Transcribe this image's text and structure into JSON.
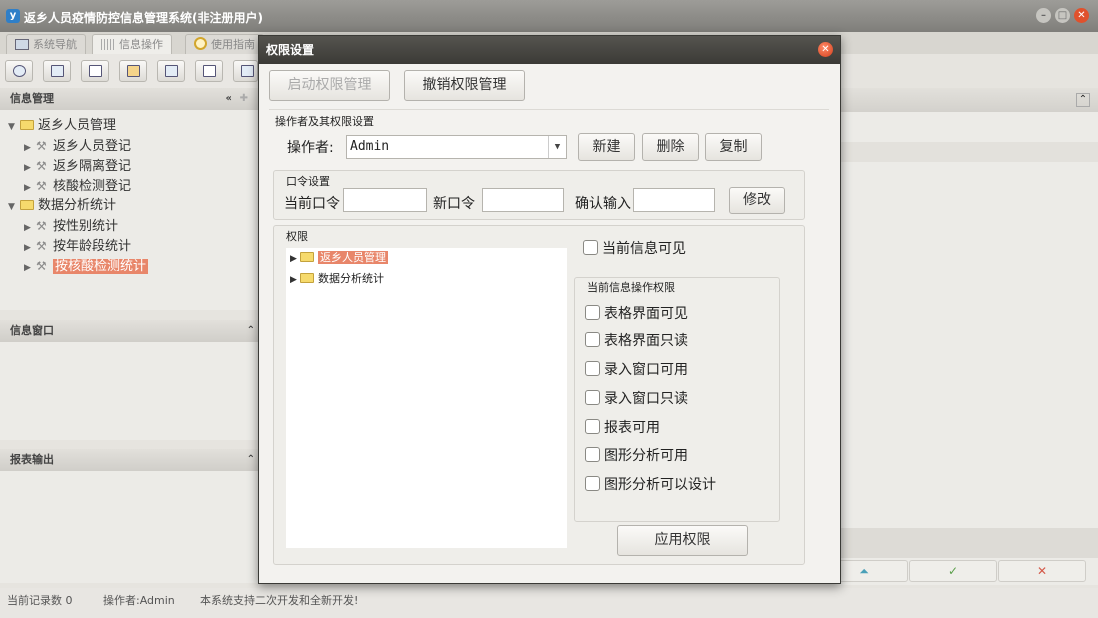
{
  "window": {
    "title": "返乡人员疫情防控信息管理系统(非注册用户)",
    "app_icon": "y"
  },
  "tabs": [
    {
      "label": "系统导航"
    },
    {
      "label": "信息操作"
    },
    {
      "label": "使用指南"
    }
  ],
  "panels": {
    "info_mgmt": "信息管理",
    "info_window": "信息窗口",
    "report_output": "报表输出"
  },
  "tree": [
    {
      "label": "返乡人员管理"
    },
    {
      "label": "返乡人员登记"
    },
    {
      "label": "返乡隔离登记"
    },
    {
      "label": "核酸检测登记"
    },
    {
      "label": "数据分析统计"
    },
    {
      "label": "按性别统计"
    },
    {
      "label": "按年龄段统计"
    },
    {
      "label": "按核酸检测统计"
    }
  ],
  "statusbar": {
    "records": "当前记录数 0",
    "operator": "操作者:Admin",
    "notice": "本系统支持二次开发和全新开发!"
  },
  "dialog": {
    "title": "权限设置",
    "start_btn": "启动权限管理",
    "revoke_btn": "撤销权限管理",
    "operator_group": "操作者及其权限设置",
    "operator_label": "操作者:",
    "operator_value": "Admin",
    "new_btn": "新建",
    "delete_btn": "删除",
    "copy_btn": "复制",
    "password_group": "口令设置",
    "current_pwd": "当前口令",
    "new_pwd": "新口令",
    "confirm_pwd": "确认输入",
    "modify_btn": "修改",
    "perm_group": "权限",
    "perm_tree": [
      "返乡人员管理",
      "数据分析统计"
    ],
    "current_visible": "当前信息可见",
    "ops_group": "当前信息操作权限",
    "ops": [
      "表格界面可见",
      "表格界面只读",
      "录入窗口可用",
      "录入窗口只读",
      "报表可用",
      "图形分析可用",
      "图形分析可以设计"
    ],
    "apply_btn": "应用权限"
  },
  "colors": {
    "selection": "#e8866a",
    "title_bar": "#8a8985",
    "dialog_title": "#3f3e3a",
    "close": "#d4401e"
  }
}
